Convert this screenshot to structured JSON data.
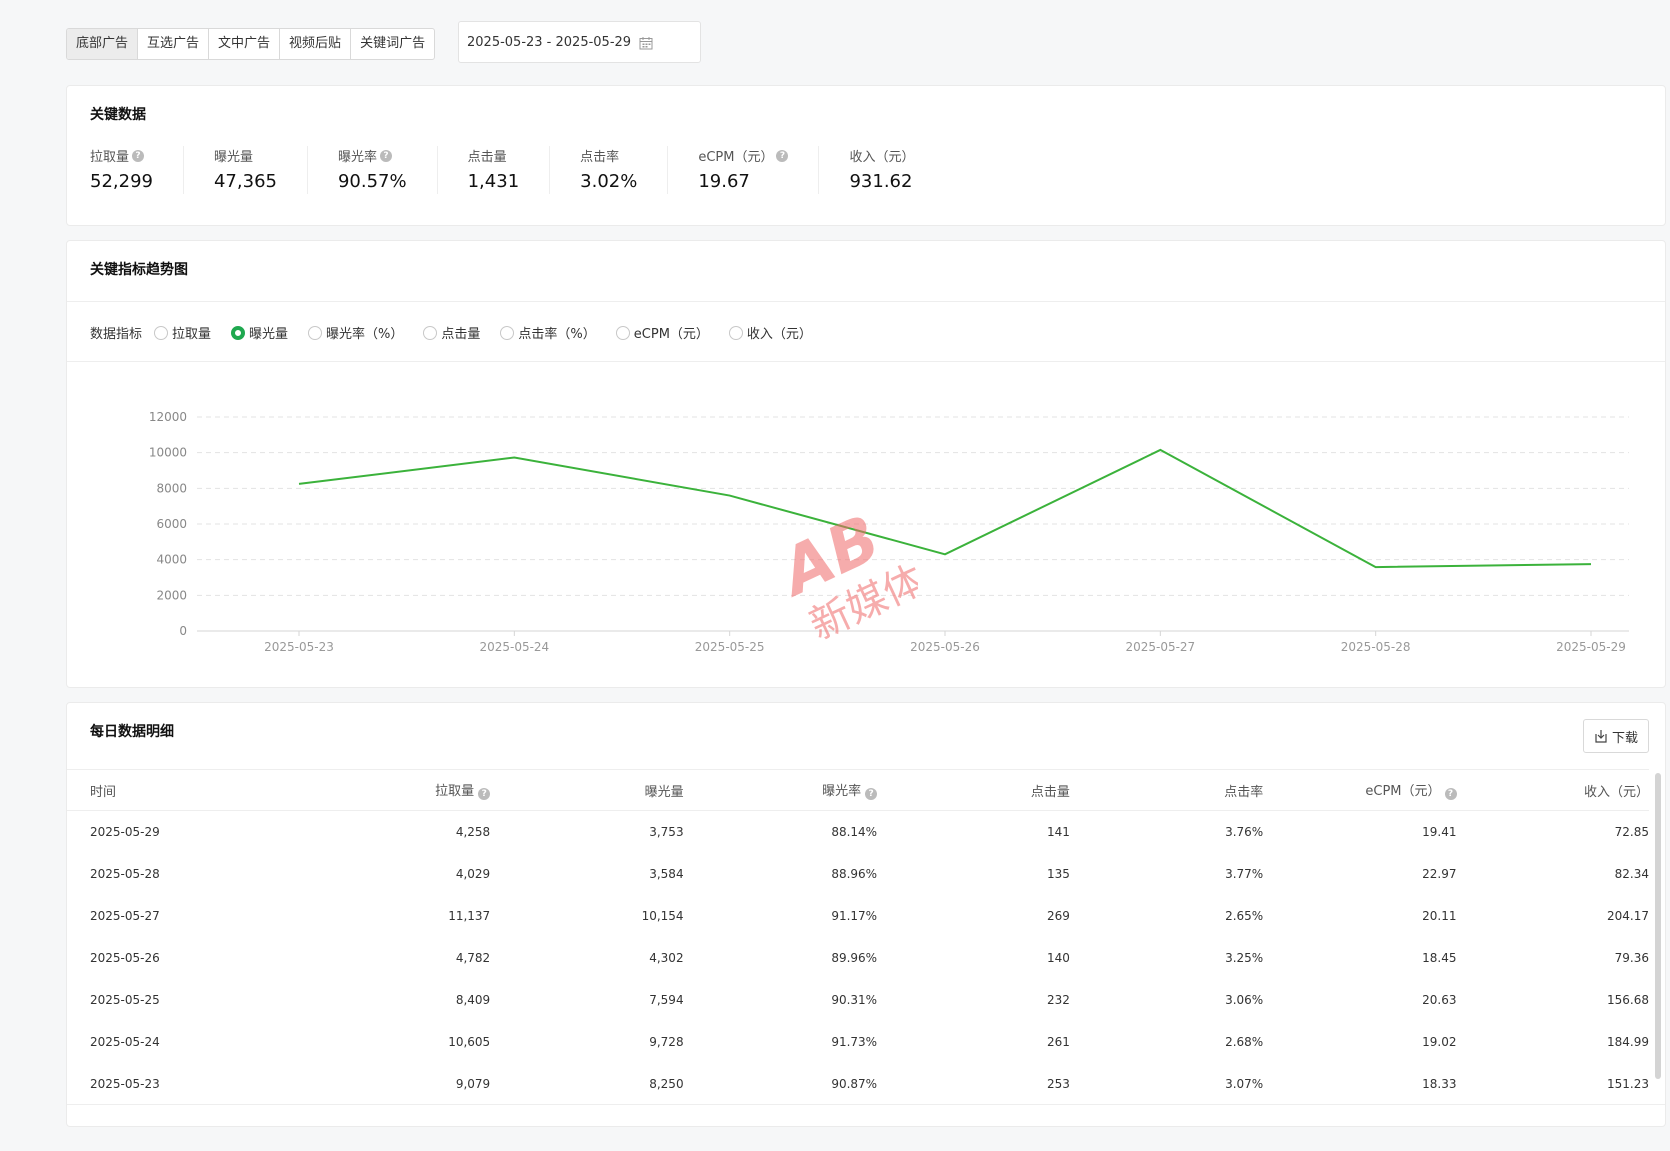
{
  "tabs": [
    {
      "label": "底部广告",
      "active": true
    },
    {
      "label": "互选广告",
      "active": false
    },
    {
      "label": "文中广告",
      "active": false
    },
    {
      "label": "视频后贴",
      "active": false
    },
    {
      "label": "关键词广告",
      "active": false
    }
  ],
  "date_range": {
    "value": "2025-05-23 - 2025-05-29"
  },
  "key_data": {
    "title": "关键数据",
    "metrics": [
      {
        "label": "拉取量",
        "value": "52,299",
        "help": true
      },
      {
        "label": "曝光量",
        "value": "47,365",
        "help": false
      },
      {
        "label": "曝光率",
        "value": "90.57%",
        "help": true
      },
      {
        "label": "点击量",
        "value": "1,431",
        "help": false
      },
      {
        "label": "点击率",
        "value": "3.02%",
        "help": false
      },
      {
        "label": "eCPM（元）",
        "value": "19.67",
        "help": true
      },
      {
        "label": "收入（元）",
        "value": "931.62",
        "help": false
      }
    ]
  },
  "trend": {
    "title": "关键指标趋势图",
    "metric_label": "数据指标",
    "options": [
      {
        "label": "拉取量",
        "checked": false
      },
      {
        "label": "曝光量",
        "checked": true
      },
      {
        "label": "曝光率（%）",
        "checked": false
      },
      {
        "label": "点击量",
        "checked": false
      },
      {
        "label": "点击率（%）",
        "checked": false
      },
      {
        "label": "eCPM（元）",
        "checked": false
      },
      {
        "label": "收入（元）",
        "checked": false
      }
    ]
  },
  "chart_data": {
    "type": "line",
    "x": [
      "2025-05-23",
      "2025-05-24",
      "2025-05-25",
      "2025-05-26",
      "2025-05-27",
      "2025-05-28",
      "2025-05-29"
    ],
    "series": [
      {
        "values": [
          8250,
          9728,
          7594,
          4302,
          10154,
          3584,
          3753
        ],
        "color": "#3bb23b"
      }
    ],
    "ylim": [
      0,
      12000
    ],
    "yticks": [
      0,
      2000,
      4000,
      6000,
      8000,
      10000,
      12000
    ],
    "grid": true
  },
  "watermark": {
    "logo": "AB",
    "text": "新媒体"
  },
  "daily": {
    "title": "每日数据明细",
    "download_label": "下载",
    "columns": [
      {
        "label": "时间",
        "help": false
      },
      {
        "label": "拉取量",
        "help": true
      },
      {
        "label": "曝光量",
        "help": false
      },
      {
        "label": "曝光率",
        "help": true
      },
      {
        "label": "点击量",
        "help": false
      },
      {
        "label": "点击率",
        "help": false
      },
      {
        "label": "eCPM（元）",
        "help": true
      },
      {
        "label": "收入（元）",
        "help": false
      }
    ],
    "rows": [
      [
        "2025-05-29",
        "4,258",
        "3,753",
        "88.14%",
        "141",
        "3.76%",
        "19.41",
        "72.85"
      ],
      [
        "2025-05-28",
        "4,029",
        "3,584",
        "88.96%",
        "135",
        "3.77%",
        "22.97",
        "82.34"
      ],
      [
        "2025-05-27",
        "11,137",
        "10,154",
        "91.17%",
        "269",
        "2.65%",
        "20.11",
        "204.17"
      ],
      [
        "2025-05-26",
        "4,782",
        "4,302",
        "89.96%",
        "140",
        "3.25%",
        "18.45",
        "79.36"
      ],
      [
        "2025-05-25",
        "8,409",
        "7,594",
        "90.31%",
        "232",
        "3.06%",
        "20.63",
        "156.68"
      ],
      [
        "2025-05-24",
        "10,605",
        "9,728",
        "91.73%",
        "261",
        "2.68%",
        "19.02",
        "184.99"
      ],
      [
        "2025-05-23",
        "9,079",
        "8,250",
        "90.87%",
        "253",
        "3.07%",
        "18.33",
        "151.23"
      ]
    ]
  }
}
